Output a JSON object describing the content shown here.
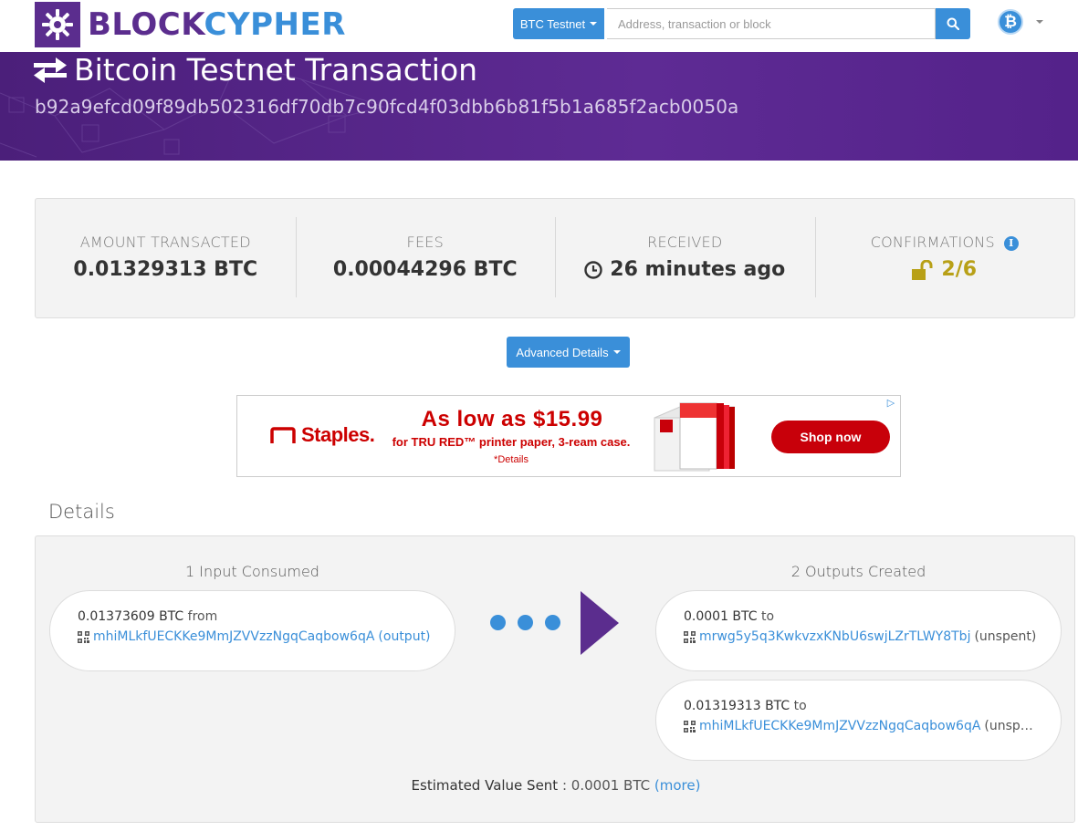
{
  "brand": {
    "block": "BLOCK",
    "cypher": "CYPHER",
    "logo_icon": "blockcypher-logo-icon"
  },
  "navbar": {
    "network_label": "BTC Testnet",
    "search_placeholder": "Address, transaction or block",
    "search_icon": "search-icon",
    "coin_icon": "bitcoin-icon",
    "coin_glyph": "₿"
  },
  "hero": {
    "title": "Bitcoin Testnet Transaction",
    "hash": "b92a9efcd09f89db502316df70db7c90fcd4f03dbb6b81f5b1a685f2acb0050a"
  },
  "summary": {
    "amount_label": "AMOUNT TRANSACTED",
    "amount_value": "0.01329313 BTC",
    "fees_label": "FEES",
    "fees_value": "0.00044296 BTC",
    "received_label": "RECEIVED",
    "received_value": "26 minutes ago",
    "confirmations_label": "CONFIRMATIONS",
    "confirmations_value": "2/6"
  },
  "advanced_details_label": "Advanced Details",
  "ad": {
    "brand": "Staples.",
    "headline": "As low as $15.99",
    "subline": "for TRU RED™ printer paper, 3-ream case.",
    "details": "*Details",
    "cta": "Shop now"
  },
  "details": {
    "heading": "Details",
    "inputs_heading": "1 Input Consumed",
    "outputs_heading": "2 Outputs Created",
    "inputs": [
      {
        "amount": "0.01373609 BTC",
        "dir": "from",
        "address": "mhiMLkfUECKKe9MmJZVVzzNgqCaqbow6qA",
        "status": "(output)"
      }
    ],
    "outputs": [
      {
        "amount": "0.0001 BTC",
        "dir": "to",
        "address": "mrwg5y5q3KwkvzxKNbU6swjLZrTLWY8Tbj",
        "status": "(unspent)"
      },
      {
        "amount": "0.01319313 BTC",
        "dir": "to",
        "address": "mhiMLkfUECKKe9MmJZVVzzNgqCaqbow6qA",
        "status": "(unsp…"
      }
    ],
    "estimate_label": "Estimated Value Sent",
    "estimate_value": ": 0.0001 BTC",
    "more_link": "(more)"
  }
}
